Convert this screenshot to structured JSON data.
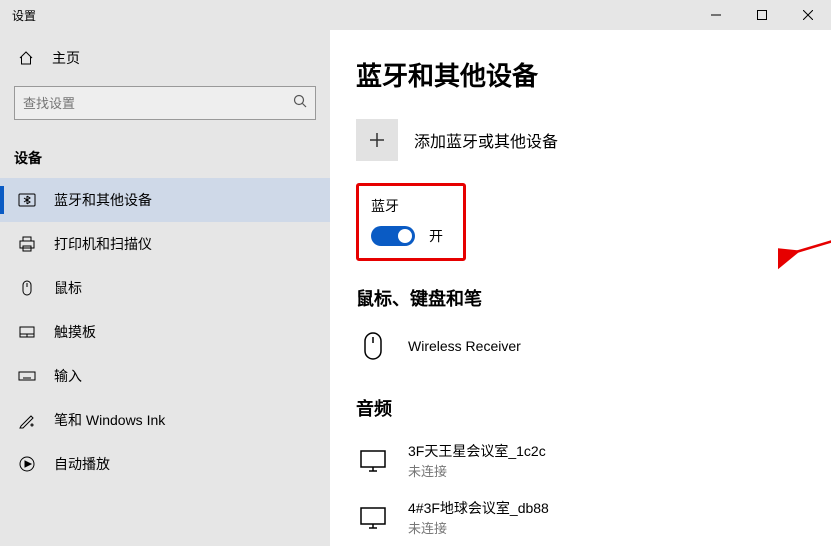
{
  "window": {
    "title": "设置"
  },
  "sidebar": {
    "home": "主页",
    "search_placeholder": "查找设置",
    "category": "设备",
    "items": [
      {
        "label": "蓝牙和其他设备",
        "icon": "bluetooth",
        "active": true
      },
      {
        "label": "打印机和扫描仪",
        "icon": "printer"
      },
      {
        "label": "鼠标",
        "icon": "mouse"
      },
      {
        "label": "触摸板",
        "icon": "touchpad"
      },
      {
        "label": "输入",
        "icon": "keyboard"
      },
      {
        "label": "笔和 Windows Ink",
        "icon": "pen"
      },
      {
        "label": "自动播放",
        "icon": "autoplay"
      }
    ]
  },
  "main": {
    "title": "蓝牙和其他设备",
    "add_label": "添加蓝牙或其他设备",
    "bluetooth_section": "蓝牙",
    "toggle_state": "开",
    "mouse_section": "鼠标、键盘和笔",
    "mouse_device": "Wireless Receiver",
    "audio_section": "音频",
    "audio_devices": [
      {
        "name": "3F天王星会议室_1c2c",
        "status": "未连接"
      },
      {
        "name": "4#3F地球会议室_db88",
        "status": "未连接"
      }
    ]
  }
}
